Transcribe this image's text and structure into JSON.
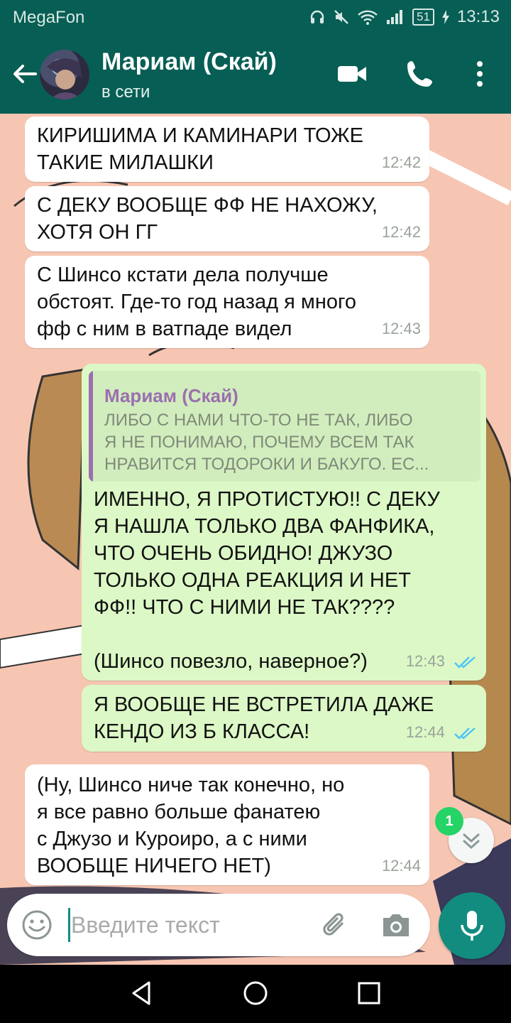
{
  "status_bar": {
    "carrier": "MegaFon",
    "battery": "51",
    "time": "13:13"
  },
  "header": {
    "contact_name": "Мариам (Скай)",
    "contact_status": "в сети"
  },
  "messages": [
    {
      "direction": "incoming",
      "text_lines": [
        "КИРИШИМА И КАМИНАРИ ТОЖЕ",
        "ТАКИЕ МИЛАШКИ"
      ],
      "time": "12:42"
    },
    {
      "direction": "incoming",
      "text_lines": [
        "С ДЕКУ ВООБЩЕ ФФ НЕ НАХОЖУ,",
        "ХОТЯ ОН ГГ"
      ],
      "time": "12:42"
    },
    {
      "direction": "incoming",
      "text_lines": [
        "С Шинсо кстати дела получше",
        "обстоят. Где-то год назад я много",
        "фф с ним в ватпаде видел"
      ],
      "time": "12:43"
    },
    {
      "direction": "outgoing",
      "quote": {
        "author": "Мариам (Скай)",
        "lines": [
          "ЛИБО С НАМИ ЧТО-ТО НЕ ТАК, ЛИБО",
          "Я НЕ ПОНИМАЮ, ПОЧЕМУ ВСЕМ ТАК",
          "НРАВИТСЯ ТОДОРОКИ И БАКУГО. ЕС..."
        ]
      },
      "text_lines": [
        "ИМЕННО, Я ПРОТИСТУЮ!! С ДЕКУ",
        "Я НАШЛА ТОЛЬКО ДВА ФАНФИКА,",
        "ЧТО ОЧЕНЬ ОБИДНО! ДЖУЗО",
        "ТОЛЬКО ОДНА РЕАКЦИЯ И НЕТ",
        "ФФ!! ЧТО С НИМИ НЕ ТАК????",
        "",
        "(Шинсо повезло, наверное?)"
      ],
      "time": "12:43",
      "read": true
    },
    {
      "direction": "outgoing",
      "text_lines": [
        "Я ВООБЩЕ НЕ ВСТРЕТИЛА ДАЖЕ",
        "КЕНДО ИЗ Б КЛАССА!"
      ],
      "time": "12:44",
      "read": true
    },
    {
      "direction": "incoming",
      "text_lines": [
        "(Ну, Шинсо ниче так конечно, но",
        "я все равно больше фанатею",
        "с Джузо и Куроиро, а с ними",
        "ВООБЩЕ НИЧЕГО НЕТ)"
      ],
      "time": "12:44"
    }
  ],
  "unread_badge": "1",
  "input": {
    "placeholder": "Введите текст"
  },
  "colors": {
    "header": "#075E54",
    "outgoing_bubble": "#dcf8c6",
    "incoming_bubble": "#ffffff",
    "accent": "#128C7E",
    "read_ticks": "#4fc3f7"
  },
  "icons": [
    "back-arrow-icon",
    "video-call-icon",
    "phone-icon",
    "more-vert-icon",
    "emoji-icon",
    "attach-icon",
    "camera-icon",
    "mic-icon",
    "chevron-down-icon",
    "nav-back-icon",
    "nav-home-icon",
    "nav-recents-icon",
    "headphones-icon",
    "mute-icon",
    "wifi-icon",
    "signal-icon",
    "charging-icon"
  ]
}
